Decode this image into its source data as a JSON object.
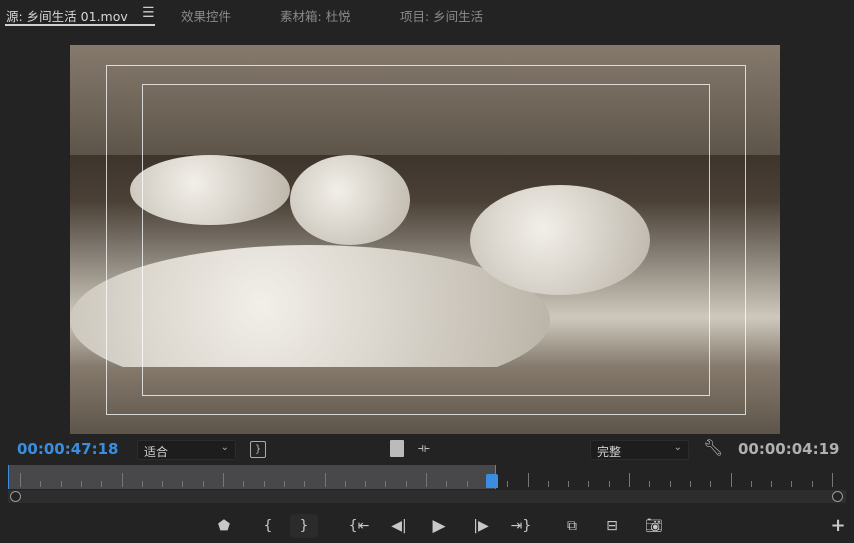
{
  "tabs": [
    {
      "label": "源: 乡间生活 01.mov",
      "active": true
    },
    {
      "label": "效果控件"
    },
    {
      "label": "素材箱: 杜悦"
    },
    {
      "label": "项目: 乡间生活"
    }
  ],
  "menu_icon": "hamburger-icon",
  "timecode_current": "00:00:47:18",
  "timecode_duration": "00:00:04:19",
  "zoom_select": "适合",
  "quality_select": "完整",
  "colors": {
    "accent": "#3b8de0",
    "background": "#232323"
  },
  "playback_progress_fraction": 0.59,
  "controls": [
    "marker",
    "mark-in",
    "mark-out",
    "go-to-in",
    "step-back",
    "play",
    "step-forward",
    "go-to-out",
    "insert",
    "overwrite",
    "export-frame",
    "add"
  ]
}
